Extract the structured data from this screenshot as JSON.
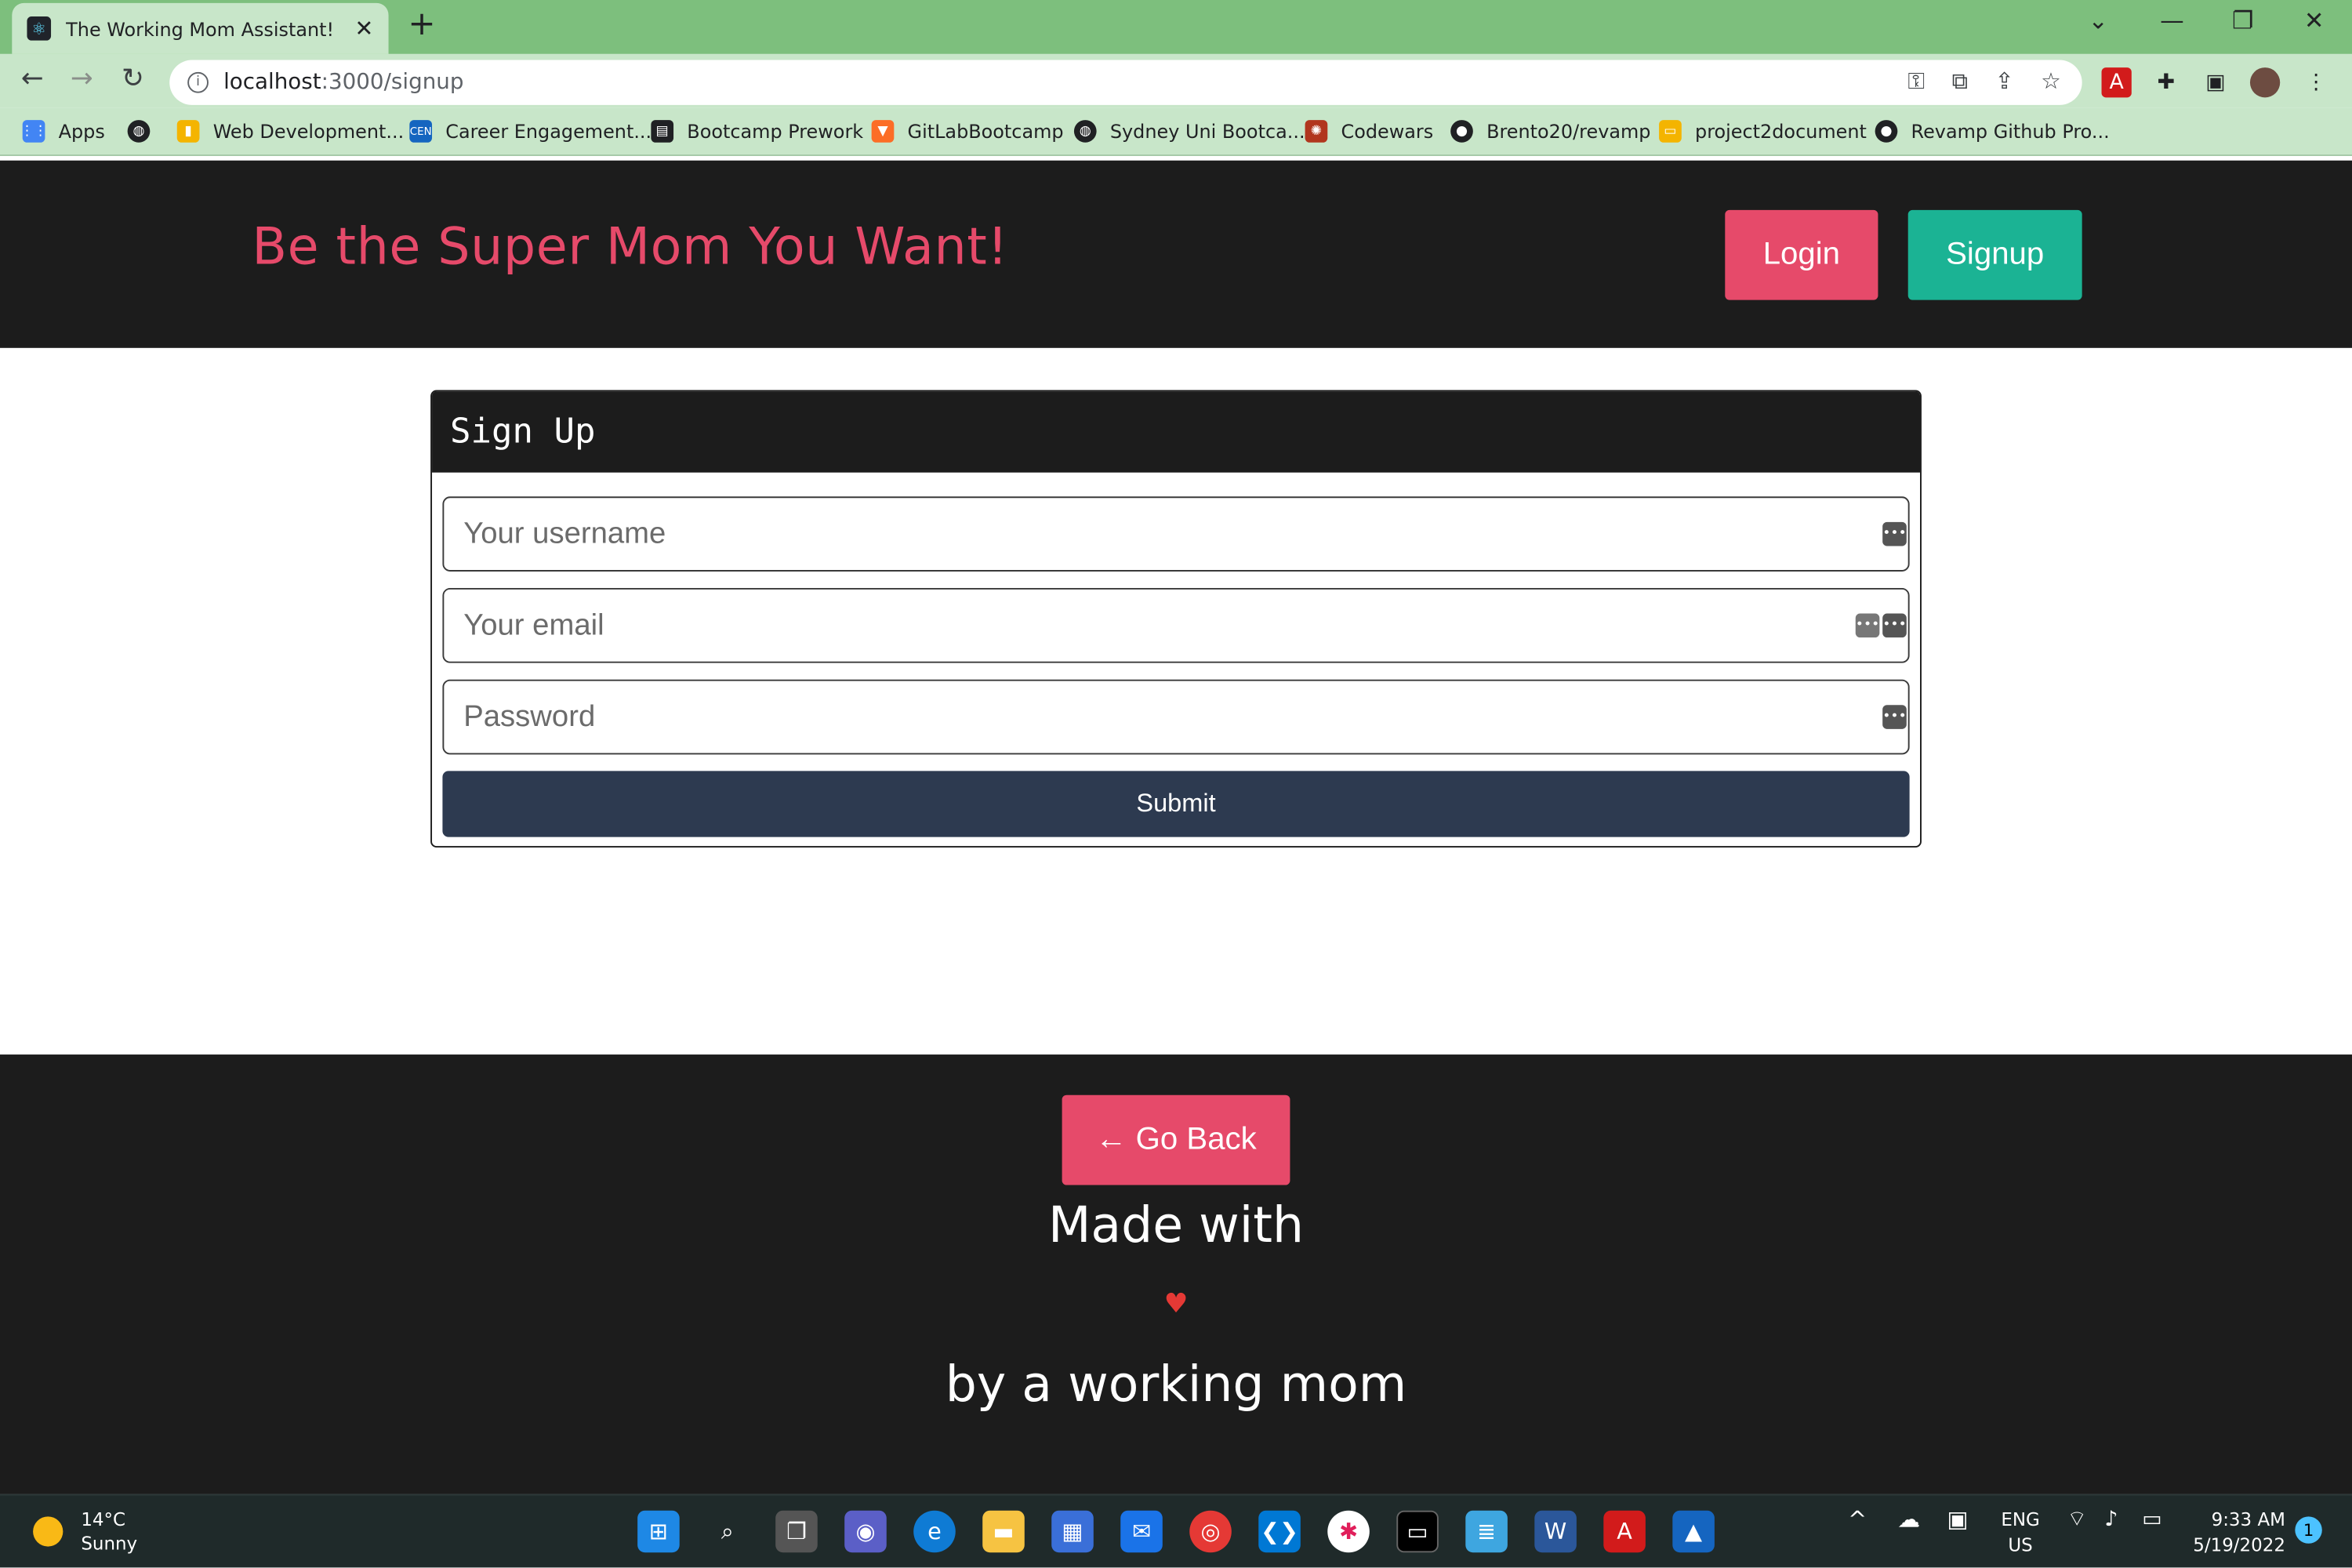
{
  "browser": {
    "tab_title": "The Working Mom Assistant!",
    "tab_close": "✕",
    "new_tab": "+",
    "url_host": "localhost",
    "url_path": ":3000/signup",
    "bookmarks": [
      {
        "label": "Apps",
        "icon": "apps-grid-icon",
        "color": "#4285f4"
      },
      {
        "label": "",
        "icon": "globe-icon",
        "color": "#202124"
      },
      {
        "label": "Web Development...",
        "icon": "bookmark-icon",
        "color": "#f4b400"
      },
      {
        "label": "Career Engagement...",
        "icon": "cen-icon",
        "color": "#1565c0"
      },
      {
        "label": "Bootcamp Prework",
        "icon": "book-icon",
        "color": "#202124"
      },
      {
        "label": "GitLabBootcamp",
        "icon": "gitlab-icon",
        "color": "#fc6d26"
      },
      {
        "label": "Sydney Uni Bootca...",
        "icon": "globe-icon",
        "color": "#202124"
      },
      {
        "label": "Codewars",
        "icon": "codewars-icon",
        "color": "#b1361e"
      },
      {
        "label": "Brento20/revamp",
        "icon": "github-icon",
        "color": "#202124"
      },
      {
        "label": "project2document",
        "icon": "slides-icon",
        "color": "#f4b400"
      },
      {
        "label": "Revamp Github Pro...",
        "icon": "github-icon",
        "color": "#202124"
      }
    ]
  },
  "header": {
    "brand": "Be the Super Mom You Want!",
    "login_label": "Login",
    "signup_label": "Signup",
    "login_color": "#e64a6a",
    "signup_color": "#1bb394"
  },
  "form": {
    "title": "Sign Up",
    "username_placeholder": "Your username",
    "email_placeholder": "Your email",
    "password_placeholder": "Password",
    "submit_label": "Submit"
  },
  "footer": {
    "go_back_label": "← Go Back",
    "made_with": "Made with",
    "heart": "♥",
    "by_line": "by a working mom"
  },
  "taskbar": {
    "temperature": "14°C",
    "condition": "Sunny",
    "language": "ENG",
    "region": "US",
    "time": "9:33 AM",
    "date": "5/19/2022",
    "notifications": "1"
  }
}
